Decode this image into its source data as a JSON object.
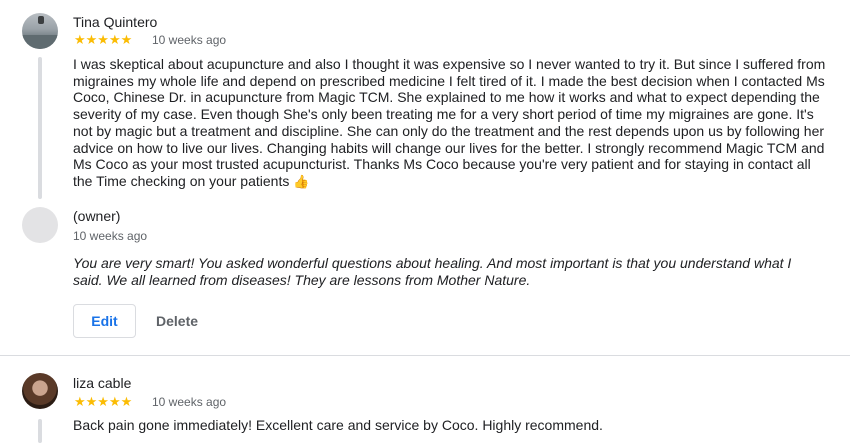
{
  "reviews": [
    {
      "author": "Tina Quintero",
      "stars": "★★★★★",
      "time": "10 weeks ago",
      "text": "I was skeptical about acupuncture and also I thought it was expensive so I never wanted to try it. But since I suffered from migraines my whole life and depend on prescribed medicine I felt tired of it. I made the best decision when I contacted Ms Coco, Chinese Dr. in acupuncture from Magic TCM. She explained to me how it works and what to expect depending the severity of my case. Even though She's only been treating me for a very short period of time my migraines are gone. It's not by magic but a treatment and discipline. She can only do the treatment and the rest depends upon us by following her advice on how to live our lives. Changing habits will change our lives for the better. I strongly recommend Magic TCM and Ms Coco as your most trusted acupuncturist. Thanks Ms Coco because you're very patient and for staying in contact all the Time checking on your patients",
      "emoji": "👍",
      "owner_reply": {
        "author": "(owner)",
        "time": "10 weeks ago",
        "text": "You are very smart! You asked wonderful questions about healing. And most important is that you understand what I said. We all learned from diseases! They are lessons from Mother Nature.",
        "edit_label": "Edit",
        "delete_label": "Delete"
      }
    },
    {
      "author": "liza cable",
      "stars": "★★★★★",
      "time": "10 weeks ago",
      "text": "Back pain gone immediately! Excellent care and service by Coco. Highly recommend."
    }
  ],
  "colors": {
    "star": "#fbbc04",
    "accent": "#1a73e8",
    "divider": "#dadce0"
  }
}
